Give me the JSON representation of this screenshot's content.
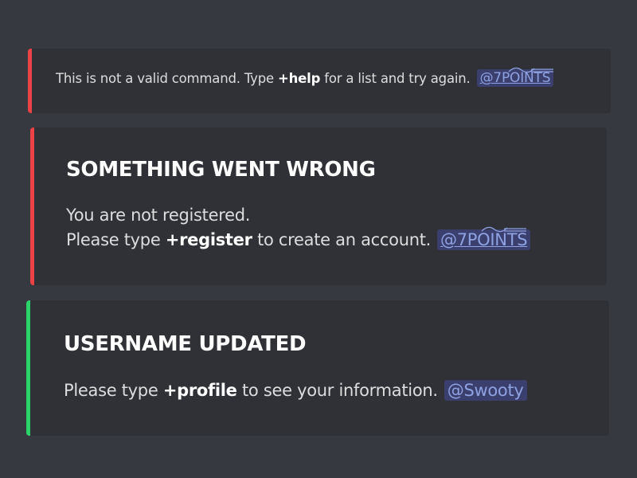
{
  "embeds": [
    {
      "accent": "#ed4245",
      "line_pre": "This is not a valid command. Type ",
      "line_bold": "+help",
      "line_post": " for a list and try again.",
      "mention": "@7POINTS"
    },
    {
      "accent": "#ed4245",
      "title": "SOMETHING WENT WRONG",
      "line1": "You are not registered.",
      "line2_pre": "Please type ",
      "line2_bold": "+register",
      "line2_post": " to create an account.",
      "mention": "@7POINTS"
    },
    {
      "accent": "#2bd46b",
      "title": "USERNAME UPDATED",
      "line_pre": "Please type ",
      "line_bold": "+profile",
      "line_post": " to see your information.",
      "mention": "@Swooty"
    }
  ],
  "colors": {
    "background": "#36393f",
    "embed_bg": "#2f3136",
    "mention_bg": "#3b3f6e",
    "mention_text": "#8ea1e1"
  }
}
